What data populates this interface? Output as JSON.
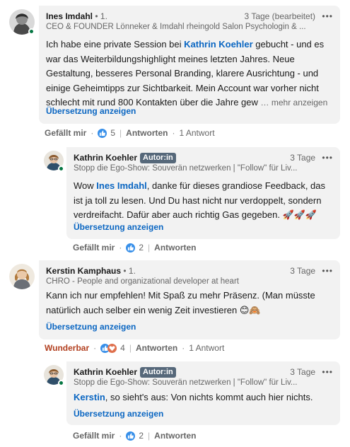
{
  "comments": [
    {
      "author": "Ines Imdahl",
      "degree": "• 1.",
      "time": "3 Tage (bearbeitet)",
      "headline": "CEO & FOUNDER Lönneker & Imdahl rheingold Salon Psychologin & ...",
      "text_parts": [
        "Ich habe eine private Session bei ",
        "Kathrin Koehler",
        " gebucht - und es war das Weiterbildungshighlight meines letzten Jahres. Neue Gestaltung, besseres Personal Branding, klarere Ausrichtung - und einige Geheimtipps zur Sichtbarkeit.  Mein Account war vorher nicht schlecht mit rund 800 Kontakten über die Jahre gew"
      ],
      "see_more": "… mehr anzeigen",
      "translate": "Übersetzung anzeigen",
      "like_label": "Gefällt mir",
      "reaction_count": "5",
      "reply_label": "Antworten",
      "reply_count": "1 Antwort",
      "avatar_color": "#5a5a5a"
    },
    {
      "author": "Kathrin Koehler",
      "badge": "Autor:in",
      "time": "3 Tage",
      "headline": "Stopp die Ego-Show: Souverän netzwerken | \"Follow\" für Liv...",
      "text_parts": [
        "Wow ",
        "Ines Imdahl",
        ", danke für dieses grandiose Feedback, das ist ja toll zu lesen. Und Du hast nicht nur verdoppelt, sondern verdreifacht. Dafür aber auch richtig Gas gegeben. ",
        "🚀🚀🚀"
      ],
      "translate": "Übersetzung anzeigen",
      "like_label": "Gefällt mir",
      "reaction_count": "2",
      "reply_label": "Antworten"
    },
    {
      "author": "Kerstin Kamphaus",
      "degree": "• 1.",
      "time": "3 Tage",
      "headline": "CHRO - People and organizational developer at heart",
      "text_parts": [
        "Kann ich nur empfehlen! Mit Spaß zu mehr Präsenz. (Man müsste natürlich auch selber ein wenig Zeit investieren ",
        "😊🙈"
      ],
      "translate": "Übersetzung anzeigen",
      "like_label": "Wunderbar",
      "reaction_count": "4",
      "reply_label": "Antworten",
      "reply_count": "1 Antwort"
    },
    {
      "author": "Kathrin Koehler",
      "badge": "Autor:in",
      "time": "3 Tage",
      "headline": "Stopp die Ego-Show: Souverän netzwerken | \"Follow\" für Liv...",
      "text_parts": [
        "Kerstin",
        ", so sieht's aus: Von nichts kommt auch hier nichts."
      ],
      "translate": "Übersetzung anzeigen",
      "like_label": "Gefällt mir",
      "reaction_count": "2",
      "reply_label": "Antworten"
    }
  ],
  "colors": {
    "link": "#0a66c2",
    "bubble": "#f2f2f2",
    "online": "#057642",
    "badge": "#56687a",
    "love": "#b24020"
  }
}
